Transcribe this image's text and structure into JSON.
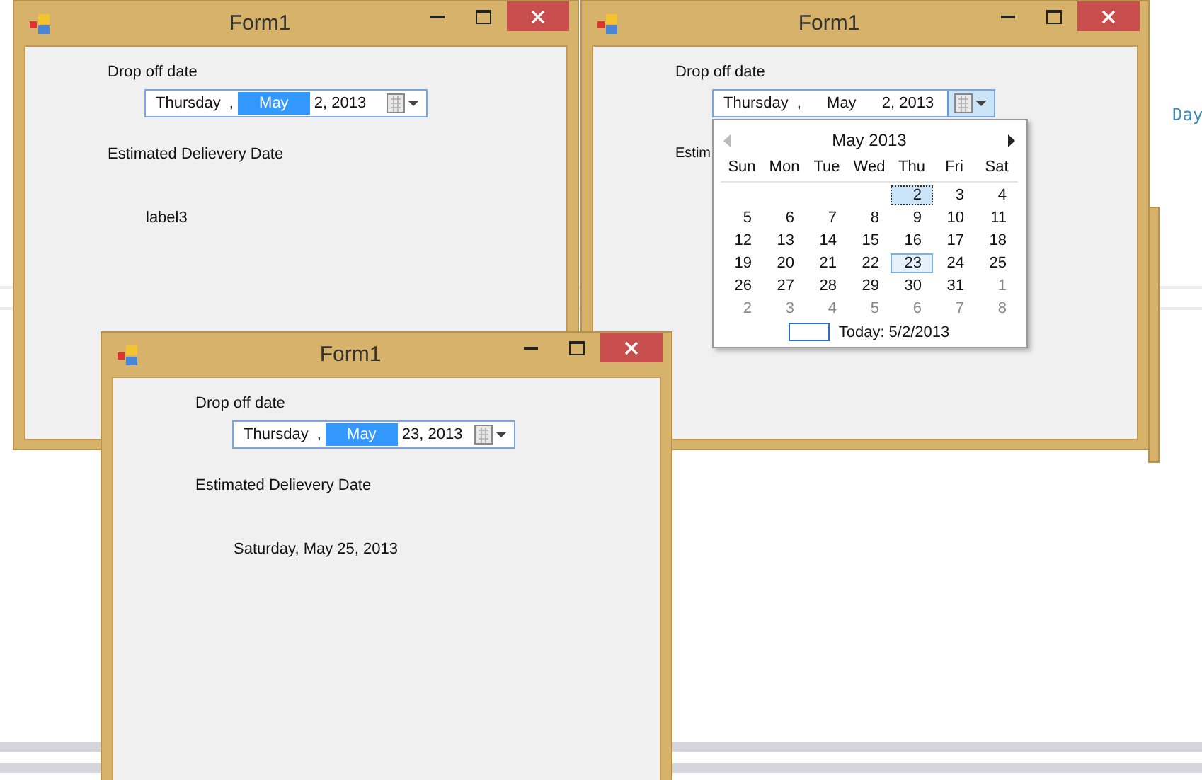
{
  "background": {
    "tab_label": "Day"
  },
  "windows": [
    {
      "title": "Form1",
      "drop_label": "Drop off date",
      "picker": {
        "weekday": "Thursday",
        "separator": ",",
        "month": "May",
        "rest": "2, 2013",
        "month_selected": true,
        "open": false
      },
      "estimate_label": "Estimated Delievery Date",
      "result": "label3"
    },
    {
      "title": "Form1",
      "drop_label": "Drop off date",
      "picker": {
        "weekday": "Thursday",
        "separator": ",",
        "month": "May",
        "rest": "2, 2013",
        "month_selected": false,
        "open": true
      },
      "estimate_label": "Estim",
      "calendar": {
        "month_title": "May 2013",
        "weekdays": [
          "Sun",
          "Mon",
          "Tue",
          "Wed",
          "Thu",
          "Fri",
          "Sat"
        ],
        "weeks": [
          [
            {
              "day": "2",
              "selected": true,
              "hovered": false,
              "muted": false
            },
            {
              "day": "3",
              "selected": false,
              "hovered": false,
              "muted": false
            },
            {
              "day": "4",
              "selected": false,
              "hovered": false,
              "muted": false
            }
          ],
          [
            {
              "day": "5",
              "selected": false,
              "hovered": false,
              "muted": false
            },
            {
              "day": "6",
              "selected": false,
              "hovered": false,
              "muted": false
            },
            {
              "day": "7",
              "selected": false,
              "hovered": false,
              "muted": false
            },
            {
              "day": "8",
              "selected": false,
              "hovered": false,
              "muted": false
            },
            {
              "day": "9",
              "selected": false,
              "hovered": false,
              "muted": false
            },
            {
              "day": "10",
              "selected": false,
              "hovered": false,
              "muted": false
            },
            {
              "day": "11",
              "selected": false,
              "hovered": false,
              "muted": false
            }
          ],
          [
            {
              "day": "12",
              "selected": false,
              "hovered": false,
              "muted": false
            },
            {
              "day": "13",
              "selected": false,
              "hovered": false,
              "muted": false
            },
            {
              "day": "14",
              "selected": false,
              "hovered": false,
              "muted": false
            },
            {
              "day": "15",
              "selected": false,
              "hovered": false,
              "muted": false
            },
            {
              "day": "16",
              "selected": false,
              "hovered": false,
              "muted": false
            },
            {
              "day": "17",
              "selected": false,
              "hovered": false,
              "muted": false
            },
            {
              "day": "18",
              "selected": false,
              "hovered": false,
              "muted": false
            }
          ],
          [
            {
              "day": "19",
              "selected": false,
              "hovered": false,
              "muted": false
            },
            {
              "day": "20",
              "selected": false,
              "hovered": false,
              "muted": false
            },
            {
              "day": "21",
              "selected": false,
              "hovered": false,
              "muted": false
            },
            {
              "day": "22",
              "selected": false,
              "hovered": false,
              "muted": false
            },
            {
              "day": "23",
              "selected": false,
              "hovered": true,
              "muted": false
            },
            {
              "day": "24",
              "selected": false,
              "hovered": false,
              "muted": false
            },
            {
              "day": "25",
              "selected": false,
              "hovered": false,
              "muted": false
            }
          ],
          [
            {
              "day": "26",
              "selected": false,
              "hovered": false,
              "muted": false
            },
            {
              "day": "27",
              "selected": false,
              "hovered": false,
              "muted": false
            },
            {
              "day": "28",
              "selected": false,
              "hovered": false,
              "muted": false
            },
            {
              "day": "29",
              "selected": false,
              "hovered": false,
              "muted": false
            },
            {
              "day": "30",
              "selected": false,
              "hovered": false,
              "muted": false
            },
            {
              "day": "31",
              "selected": false,
              "hovered": false,
              "muted": false
            },
            {
              "day": "1",
              "selected": false,
              "hovered": false,
              "muted": true
            }
          ],
          [
            {
              "day": "2",
              "selected": false,
              "hovered": false,
              "muted": true
            },
            {
              "day": "3",
              "selected": false,
              "hovered": false,
              "muted": true
            },
            {
              "day": "4",
              "selected": false,
              "hovered": false,
              "muted": true
            },
            {
              "day": "5",
              "selected": false,
              "hovered": false,
              "muted": true
            },
            {
              "day": "6",
              "selected": false,
              "hovered": false,
              "muted": true
            },
            {
              "day": "7",
              "selected": false,
              "hovered": false,
              "muted": true
            },
            {
              "day": "8",
              "selected": false,
              "hovered": false,
              "muted": true
            }
          ]
        ],
        "today_label": "Today: 5/2/2013"
      }
    },
    {
      "title": "Form1",
      "drop_label": "Drop off date",
      "picker": {
        "weekday": "Thursday",
        "separator": ",",
        "month": "May",
        "rest": "23, 2013",
        "month_selected": true,
        "open": false
      },
      "estimate_label": "Estimated Delievery Date",
      "result": "Saturday, May 25, 2013"
    }
  ]
}
